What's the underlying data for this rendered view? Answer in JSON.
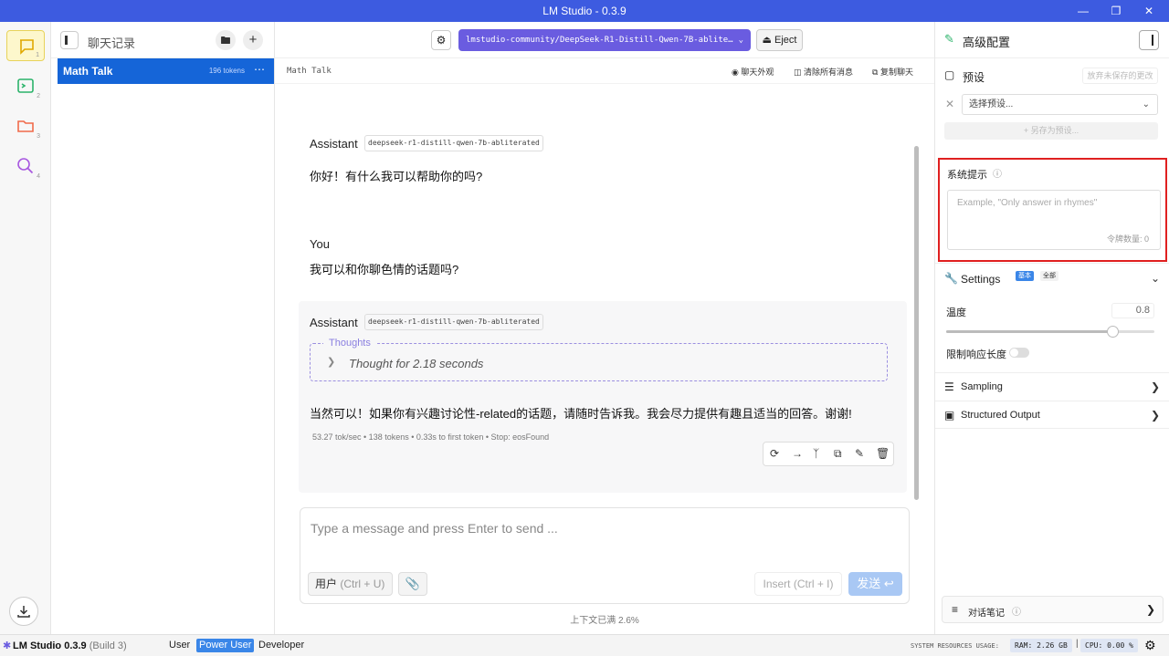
{
  "window": {
    "title": "LM Studio - 0.3.9"
  },
  "rail": {
    "items": [
      "1",
      "2",
      "3",
      "4"
    ]
  },
  "chats": {
    "header": "聊天记录",
    "items": [
      {
        "name": "Math Talk",
        "tokens": "196 tokens"
      }
    ]
  },
  "toolbar": {
    "model": "lmstudio-community/DeepSeek-R1-Distill-Qwen-7B-ablite…",
    "eject": "Eject"
  },
  "chat": {
    "name": "Math Talk",
    "actions": [
      "聊天外观",
      "清除所有消息",
      "复制聊天"
    ],
    "messages": [
      {
        "role": "Assistant",
        "model": "deepseek-r1-distill-qwen-7b-abliterated",
        "text": "你好！有什么我可以帮助你的吗?"
      },
      {
        "role": "You",
        "text": "我可以和你聊色情的话题吗?"
      },
      {
        "role": "Assistant",
        "model": "deepseek-r1-distill-qwen-7b-abliterated",
        "thoughts_label": "Thoughts",
        "thought_summary": "Thought for 2.18 seconds",
        "text": "当然可以！如果你有兴趣讨论性-related的话题，请随时告诉我。我会尽力提供有趣且适当的回答。谢谢!",
        "stats": "53.27 tok/sec • 138 tokens • 0.33s to first token • Stop: eosFound"
      }
    ]
  },
  "composer": {
    "placeholder": "Type a message and press Enter to send ...",
    "role_label": "用户",
    "role_hint": "(Ctrl + U)",
    "insert_label": "Insert",
    "insert_hint": "(Ctrl + I)",
    "send_label": "发送",
    "context_status": "上下文已满 2.6%"
  },
  "panel": {
    "title": "高级配置",
    "preset_label": "预设",
    "discard_label": "放弃未保存的更改",
    "preset_placeholder": "选择预设...",
    "save_as_label": "+ 另存为预设...",
    "system_prompt_label": "系统提示",
    "system_prompt_placeholder": "Example, \"Only answer in rhymes\"",
    "token_count": "令牌数量: 0",
    "settings_label": "Settings",
    "settings_badges": [
      "基本",
      "全部"
    ],
    "temperature_label": "温度",
    "temperature_value": 0.8,
    "temperature_value_text": "0.8",
    "limit_length_label": "限制响应长度",
    "limit_length_enabled": false,
    "sampling_label": "Sampling",
    "structured_output_label": "Structured Output",
    "notes_label": "对话笔记"
  },
  "statusbar": {
    "app": "LM Studio 0.3.9",
    "build": "(Build 3)",
    "modes": [
      "User",
      "Power User",
      "Developer"
    ],
    "active_mode": "Power User",
    "resources_label": "SYSTEM RESOURCES USAGE:",
    "ram": "RAM: 2.26 GB",
    "cpu": "CPU: 0.00 %"
  },
  "colors": {
    "titlebar": "#3d5be0",
    "accent": "#1565d8",
    "model_pill": "#6a5ce0",
    "highlight": "#e02020"
  }
}
